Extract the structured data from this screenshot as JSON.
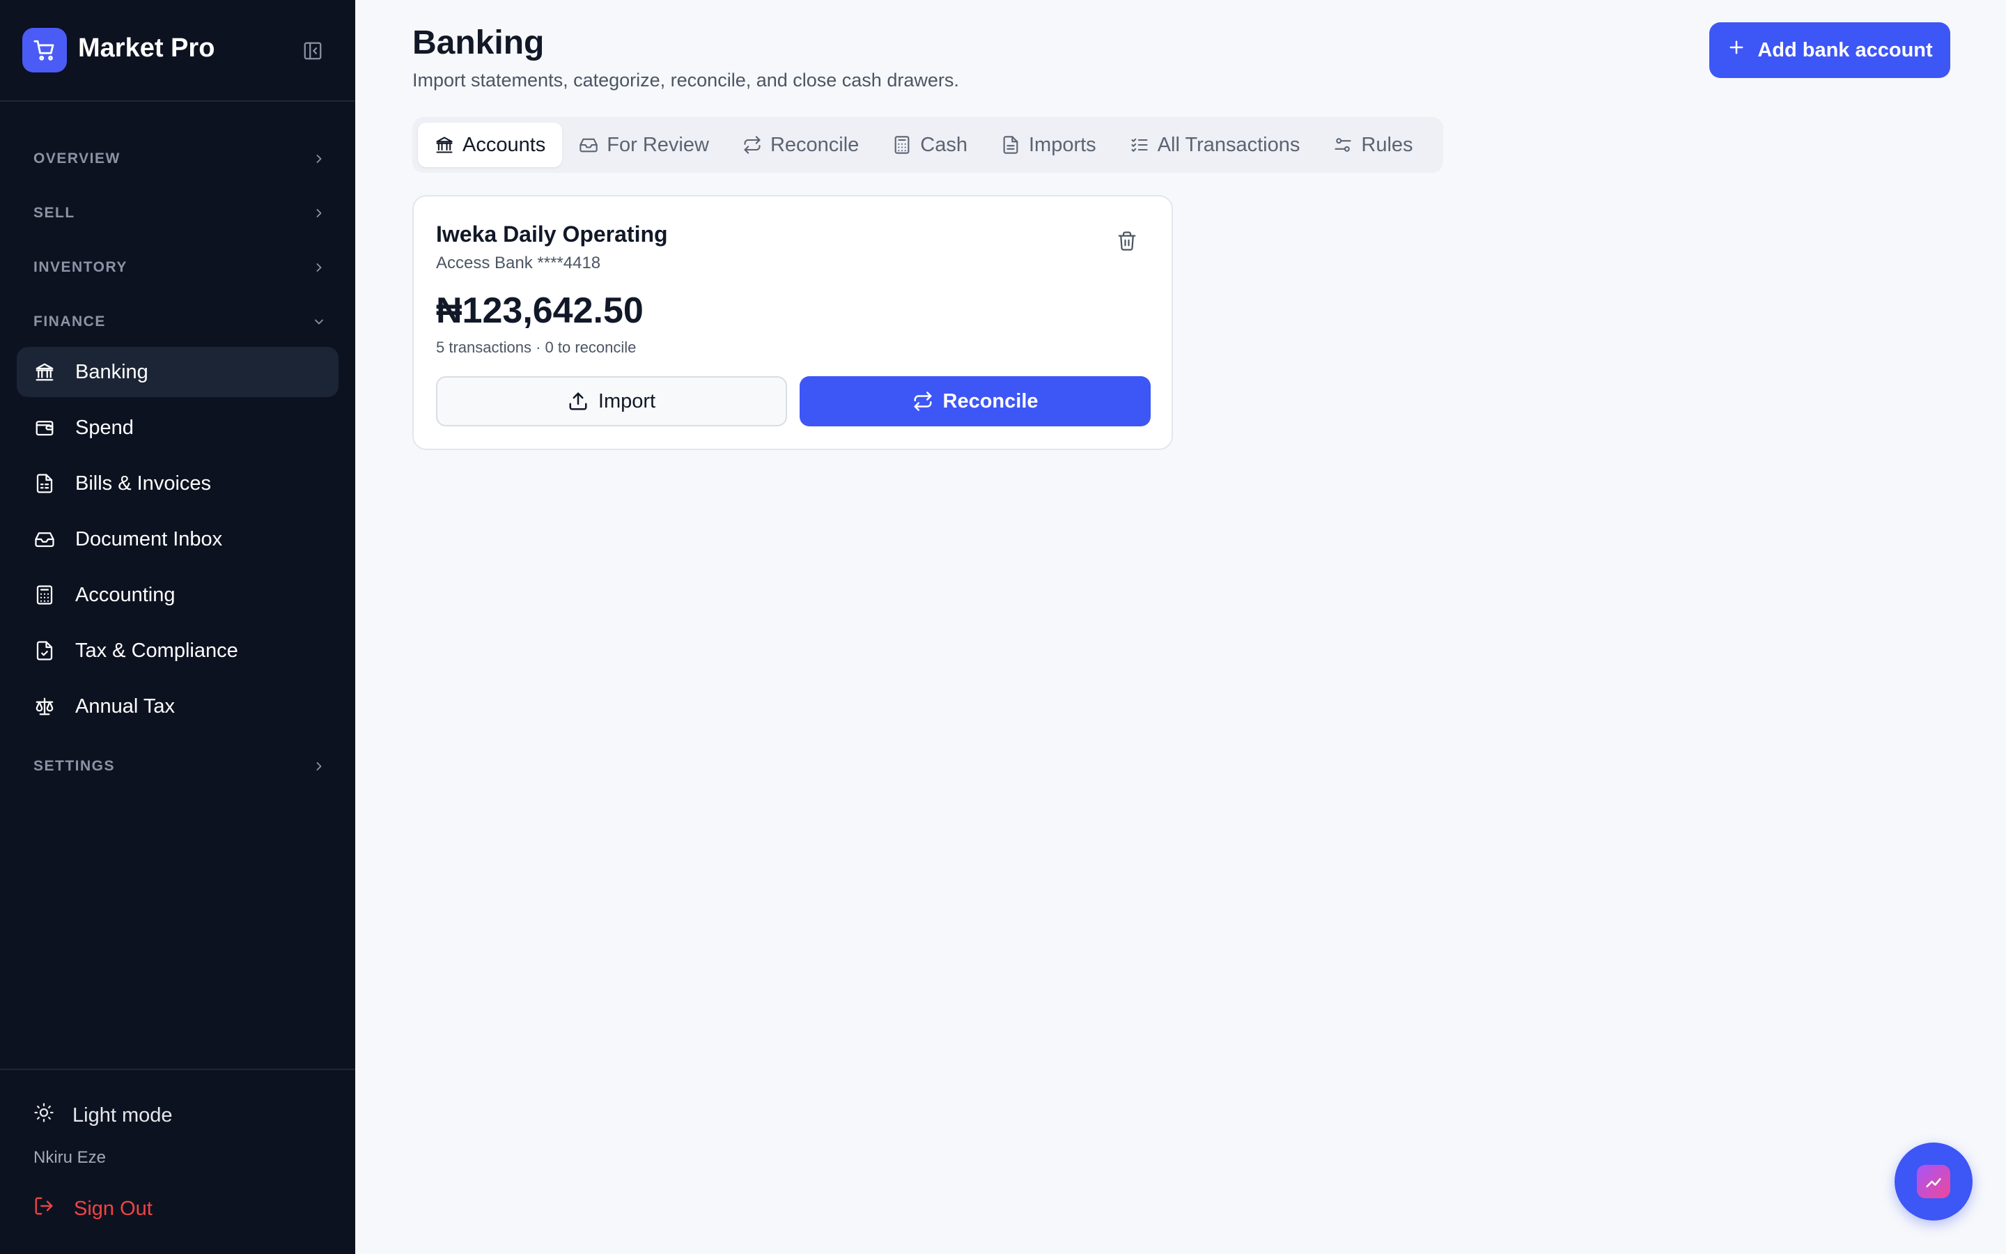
{
  "app": {
    "name": "Market Pro"
  },
  "sidebar": {
    "sections": [
      {
        "label": "OVERVIEW"
      },
      {
        "label": "SELL"
      },
      {
        "label": "INVENTORY"
      },
      {
        "label": "FINANCE"
      },
      {
        "label": "SETTINGS"
      }
    ],
    "finance_items": [
      {
        "label": "Banking",
        "icon": "bank-icon",
        "active": true
      },
      {
        "label": "Spend",
        "icon": "wallet-icon"
      },
      {
        "label": "Bills & Invoices",
        "icon": "invoice-icon"
      },
      {
        "label": "Document Inbox",
        "icon": "inbox-icon"
      },
      {
        "label": "Accounting",
        "icon": "calculator-icon"
      },
      {
        "label": "Tax & Compliance",
        "icon": "file-check-icon"
      },
      {
        "label": "Annual Tax",
        "icon": "scale-icon"
      }
    ],
    "footer": {
      "theme_label": "Light mode",
      "user_name": "Nkiru Eze",
      "sign_out_label": "Sign Out"
    }
  },
  "header": {
    "title": "Banking",
    "subtitle": "Import statements, categorize, reconcile, and close cash drawers.",
    "add_button_label": "Add bank account"
  },
  "tabs": [
    {
      "label": "Accounts",
      "icon": "bank-icon",
      "active": true
    },
    {
      "label": "For Review",
      "icon": "inbox-icon"
    },
    {
      "label": "Reconcile",
      "icon": "repeat-icon"
    },
    {
      "label": "Cash",
      "icon": "calculator-icon"
    },
    {
      "label": "Imports",
      "icon": "file-icon"
    },
    {
      "label": "All Transactions",
      "icon": "list-check-icon"
    },
    {
      "label": "Rules",
      "icon": "sliders-icon"
    }
  ],
  "account": {
    "name": "Iweka Daily Operating",
    "bank": "Access Bank ****4418",
    "balance": "₦123,642.50",
    "meta": "5 transactions · 0 to reconcile",
    "import_label": "Import",
    "reconcile_label": "Reconcile"
  },
  "colors": {
    "accent": "#3d56f6",
    "sidebar_bg": "#0d1220",
    "danger": "#ef4444"
  }
}
